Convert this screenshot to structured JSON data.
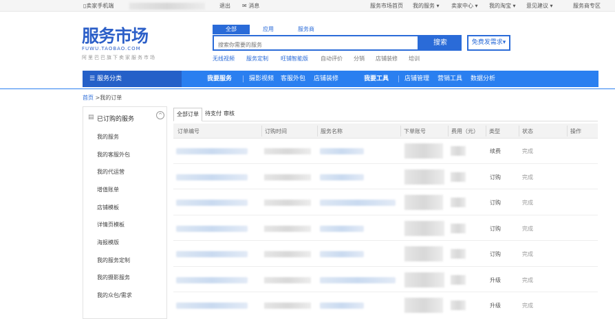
{
  "topbar": {
    "mobile": "卖家手机端",
    "logout": "退出",
    "message": "消息",
    "links": [
      "服务市场首页",
      "我的服务",
      "卖家中心",
      "我的淘宝",
      "意见建议",
      "服务商专区"
    ]
  },
  "logo": {
    "text": "服务市场",
    "sub": "FUWU.TAOBAO.COM",
    "slogan": "阿里巴巴旗下卖家服务市场"
  },
  "search": {
    "tabs": [
      "全部",
      "应用",
      "服务商"
    ],
    "placeholder": "搜索你需要的服务",
    "button": "搜索",
    "free_button": "免费发需求",
    "hot_links": [
      "无线视频",
      "服务定制",
      "旺铺智能版",
      "自动评价",
      "分销",
      "店铺装修",
      "培训"
    ]
  },
  "nav": {
    "category": "服务分类",
    "group1_title": "我要服务",
    "group1": [
      "摄影视频",
      "客服外包",
      "店铺装修"
    ],
    "group2_title": "我要工具",
    "group2": [
      "店铺管理",
      "营销工具",
      "数据分析"
    ]
  },
  "breadcrumb": {
    "home": "首页",
    "current": ">我的订单"
  },
  "sidebar": {
    "title": "已订购的服务",
    "items": [
      "我的服务",
      "我的客服外包",
      "我的代运营",
      "增值账单",
      "店铺模板",
      "详情页模板",
      "海报模版",
      "我的服务定制",
      "我的摄影服务",
      "我的众包/需求"
    ]
  },
  "orders": {
    "tabs": [
      "全部订单",
      "待支付",
      "审核"
    ],
    "columns": [
      "订单编号",
      "订购时间",
      "服务名称",
      "下单账号",
      "费用（元）",
      "类型",
      "状态",
      "操作"
    ],
    "rows": [
      {
        "type": "续费",
        "status": "完成"
      },
      {
        "type": "订购",
        "status": "完成"
      },
      {
        "type": "订购",
        "status": "完成"
      },
      {
        "type": "订购",
        "status": "完成"
      },
      {
        "type": "订购",
        "status": "完成"
      },
      {
        "type": "升级",
        "status": "完成"
      },
      {
        "type": "升级",
        "status": "完成"
      }
    ]
  },
  "colors": {
    "brand": "#2a7ff0",
    "brand_dark": "#2560c8",
    "logo_accent": "#e85a22"
  }
}
